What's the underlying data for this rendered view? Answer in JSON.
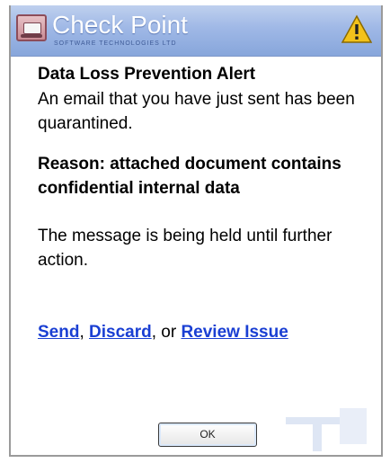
{
  "header": {
    "brand": "Check Point",
    "brand_sub": "SOFTWARE TECHNOLOGIES LTD",
    "icon": "warning-triangle-icon"
  },
  "alert": {
    "title": "Data Loss Prevention Alert",
    "message": "An email that you have just sent has been quarantined.",
    "reason": "Reason: attached document contains confidential internal data",
    "status": "The message is being held until further action."
  },
  "actions": {
    "send": "Send",
    "sep1": ", ",
    "discard": "Discard",
    "sep2": ", or ",
    "review": "Review Issue"
  },
  "buttons": {
    "ok": "OK"
  },
  "colors": {
    "titlebar": "#9fb8e6",
    "link": "#1a3fd3",
    "warning": "#f3c21b"
  }
}
